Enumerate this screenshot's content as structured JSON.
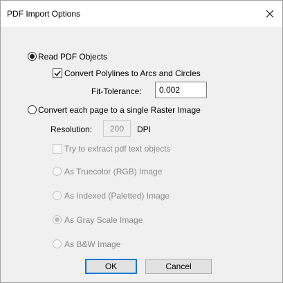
{
  "window": {
    "title": "PDF Import Options",
    "close_glyph": "✕"
  },
  "options": {
    "read_pdf_objects": {
      "label": "Read PDF Objects",
      "selected": true
    },
    "convert_polylines": {
      "label": "Convert Polylines to Arcs and Circles",
      "checked": true
    },
    "fit_tolerance": {
      "label": "Fit-Tolerance:",
      "value": "0.002"
    },
    "convert_raster": {
      "label": "Convert each page to a single Raster Image",
      "selected": false
    },
    "resolution": {
      "label": "Resolution:",
      "value": "200",
      "unit": "DPI"
    },
    "extract_text": {
      "label": "Try to extract pdf text objects",
      "checked": false
    },
    "as_truecolor": {
      "label": "As Truecolor (RGB) Image"
    },
    "as_indexed": {
      "label": "As Indexed (Paletted) Image"
    },
    "as_grayscale": {
      "label": "As Gray Scale Image",
      "selected": true
    },
    "as_bw": {
      "label": "As B&W Image"
    }
  },
  "buttons": {
    "ok": "OK",
    "cancel": "Cancel"
  },
  "colors": {
    "default_button_border": "#0078d7",
    "disabled_text": "#8a8a8a"
  }
}
